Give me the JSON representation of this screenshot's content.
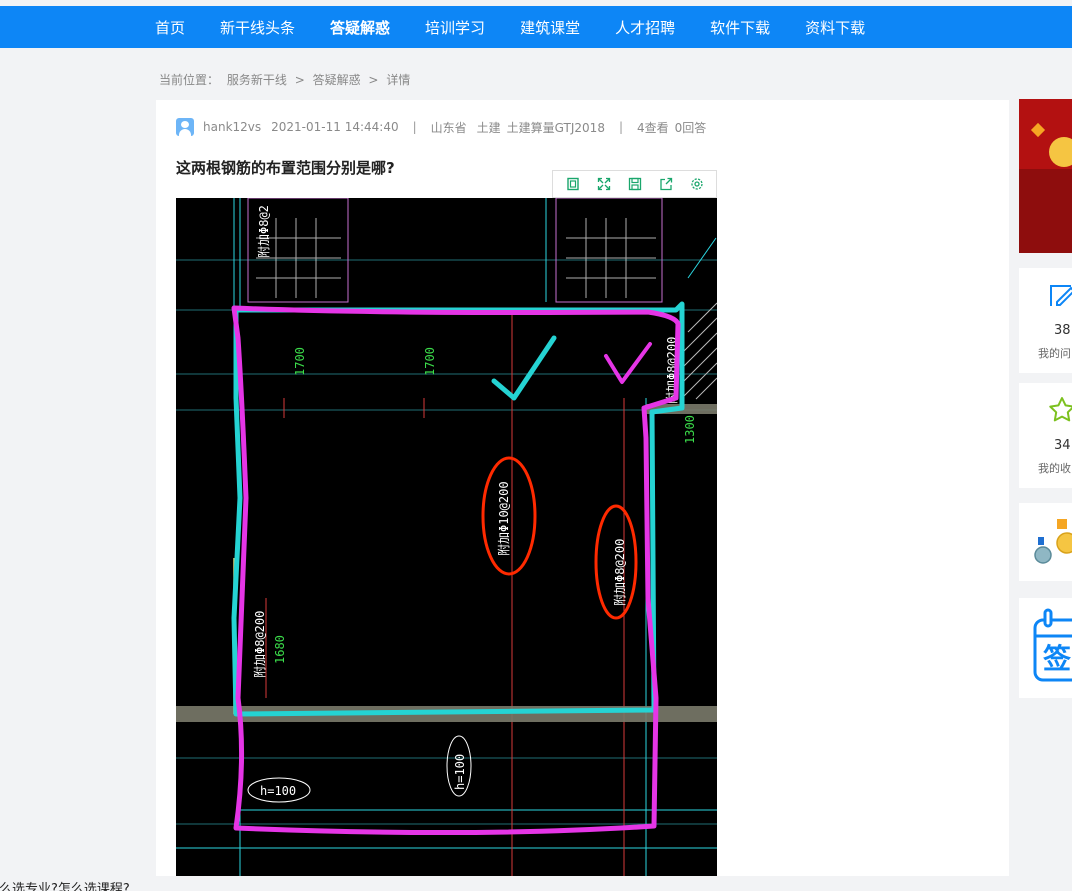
{
  "nav": {
    "items": [
      {
        "label": "首页",
        "active": false
      },
      {
        "label": "新干线头条",
        "active": false
      },
      {
        "label": "答疑解惑",
        "active": true
      },
      {
        "label": "培训学习",
        "active": false
      },
      {
        "label": "建筑课堂",
        "active": false
      },
      {
        "label": "人才招聘",
        "active": false
      },
      {
        "label": "软件下载",
        "active": false
      },
      {
        "label": "资料下载",
        "active": false
      }
    ]
  },
  "breadcrumb": {
    "prefix": "当前位置：",
    "items": [
      "服务新干线",
      "答疑解惑",
      "详情"
    ],
    "separator": ">"
  },
  "question": {
    "user": "hank12vs",
    "datetime": "2021-01-11 14:44:40",
    "province": "山东省",
    "category": "土建",
    "software": "土建算量GTJ2018",
    "views": "4查看",
    "answers": "0回答",
    "title": "这两根钢筋的布置范围分别是哪?",
    "divider": "|"
  },
  "toolbar": {
    "icons": [
      "fit-page-icon",
      "fullscreen-icon",
      "save-icon",
      "share-icon",
      "settings-icon"
    ]
  },
  "drawing": {
    "labels": {
      "d1": "1700",
      "d2": "1700",
      "d3": "1300",
      "d4": "1680",
      "r1": "附加Φ10@200",
      "r2": "附加Φ8@200",
      "r3": "附加Φ8@200",
      "r4": "附加Φ8@200",
      "r5": "附加Φ8@2",
      "h1": "h=100",
      "h2": "h=100"
    }
  },
  "sidebar": {
    "my_questions": {
      "count": "38",
      "label": "我的问"
    },
    "my_favorites": {
      "count": "34",
      "label": "我的收"
    }
  },
  "footer": {
    "text": "怎么选专业?怎么选课程?"
  },
  "colors": {
    "brand": "#0d86f6",
    "page_bg": "#f2f3f5",
    "icon_green": "#1aa66c",
    "annot_magenta": "#e535e6",
    "annot_cyan": "#25d3d3",
    "annot_red": "#ff2a00"
  }
}
